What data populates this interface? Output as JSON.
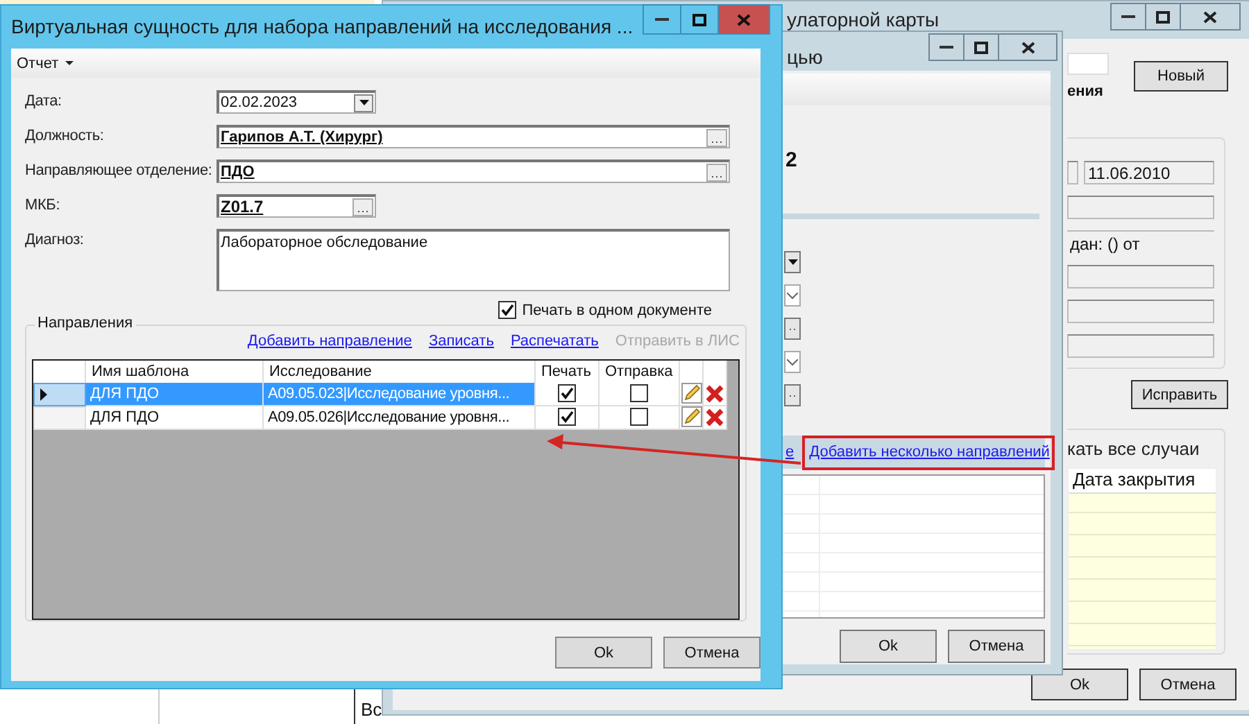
{
  "desktop": {
    "cell_text": "Вс"
  },
  "back_window": {
    "title": "улаторной карты",
    "new_button": "Новый",
    "bold_label": "ения",
    "date_value": "11.06.2010",
    "issued_text": "дан: () от",
    "edit_button": "Исправить",
    "group_label": "кать все случаи",
    "table_columns": [
      "Дата закрытия"
    ],
    "buttons": [
      "Ok",
      "Отмена"
    ]
  },
  "middle_window": {
    "title": "цью",
    "number_label": "2",
    "cut_link": "е",
    "highlighted_link": "Добавить несколько направлений",
    "buttons": [
      "Ok",
      "Отмена"
    ]
  },
  "dialog": {
    "title": "Виртуальная сущность для набора направлений на исследования ...",
    "menu": [
      {
        "label": "Отчет"
      }
    ],
    "fields": [
      {
        "label": "Дата:",
        "value": "02.02.2023",
        "kind": "date"
      },
      {
        "label": "Должность:",
        "value": "Гарипов А.Т. (Хирург)",
        "kind": "lookup"
      },
      {
        "label": "Направляющее отделение:",
        "value": "ПДО",
        "kind": "lookup"
      },
      {
        "label": "МКБ:",
        "value": "Z01.7",
        "kind": "code"
      },
      {
        "label": "Диагноз:",
        "value": "Лабораторное обследование",
        "kind": "memo"
      }
    ],
    "print_single": {
      "label": "Печать в одном документе",
      "checked": true
    },
    "group_label": "Направления",
    "actions": [
      {
        "label": "Добавить направление",
        "disabled": false
      },
      {
        "label": "Записать",
        "disabled": false
      },
      {
        "label": "Распечатать",
        "disabled": false
      },
      {
        "label": "Отправить в ЛИС",
        "disabled": true
      }
    ],
    "table": {
      "columns": [
        "Имя шаблона",
        "Исследование",
        "Печать",
        "Отправка"
      ],
      "rows": [
        {
          "template": "ДЛЯ ПДО",
          "study": "A09.05.023|Исследование уровня...",
          "print": true,
          "send": false,
          "selected": true
        },
        {
          "template": "ДЛЯ ПДО",
          "study": "A09.05.026|Исследование уровня...",
          "print": true,
          "send": false,
          "selected": false
        }
      ]
    },
    "buttons": [
      "Ok",
      "Отмена"
    ]
  }
}
